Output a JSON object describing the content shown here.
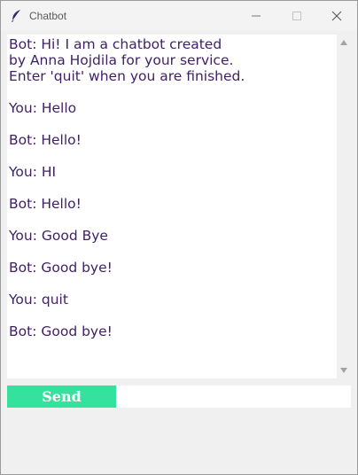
{
  "window": {
    "title": "Chatbot",
    "icon": "feather-icon"
  },
  "chat": {
    "transcript": "Bot: Hi! I am a chatbot created\nby Anna Hojdila for your service.\nEnter 'quit' when you are finished.\n\nYou: Hello\n\nBot: Hello!\n\nYou: HI\n\nBot: Hello!\n\nYou: Good Bye\n\nBot: Good bye!\n\nYou: quit\n\nBot: Good bye!"
  },
  "controls": {
    "send_label": "Send",
    "input_value": ""
  },
  "colors": {
    "chat_text": "#3f1f66",
    "send_button": "#35e29d"
  }
}
